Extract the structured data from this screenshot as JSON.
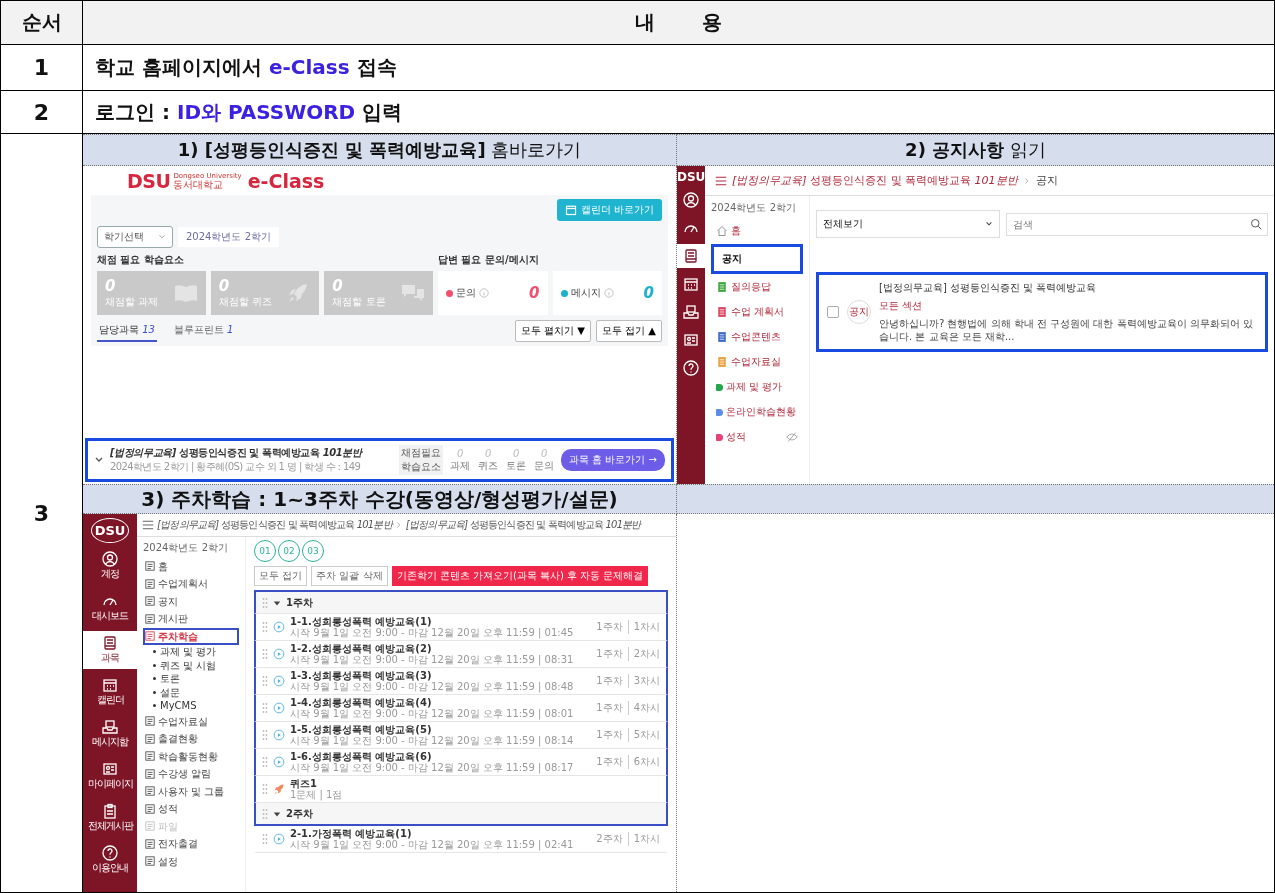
{
  "table": {
    "columns": [
      "순서",
      "내 용"
    ]
  },
  "steps": [
    {
      "number": "1",
      "text": "학교 홈페이지에서 **e-Class** 접속"
    },
    {
      "number": "2",
      "text": "로그인 : **ID와 PASSWORD** 입력"
    },
    {
      "number": "3",
      "panels": [
        {
          "caption": "**1) [성평등인식증진 및 폭력예방교육]** 홈바로가기",
          "caption_bold": false,
          "screen": {
            "kind": "dashboard",
            "logo": {
              "mark": "DSU",
              "name_en": "Dongseo University",
              "name_ko": "동서대학교",
              "product": "e-Class"
            },
            "calendar_button": "캘린더 바로가기",
            "semester_select": "학기선택",
            "semester_value": "2024학년도 2학기",
            "grading_title": "채점 필요 학습요소",
            "grading_cards": [
              {
                "kind": "book",
                "count": "0",
                "label": "채점할 과제"
              },
              {
                "kind": "rocket",
                "count": "0",
                "label": "채점할 퀴즈"
              },
              {
                "kind": "chat",
                "count": "0",
                "label": "채점할 토론"
              }
            ],
            "reply_title": "답변 필요 문의/메시지",
            "reply_cards": [
              {
                "label": "문의",
                "count": "0",
                "color": "#f0506e"
              },
              {
                "label": "메시지",
                "count": "0",
                "color": "#1ab0d0"
              }
            ],
            "tabs": [
              {
                "label": "담당과목",
                "count": "13",
                "selected": true
              },
              {
                "label": "블루프린트",
                "count": "1",
                "selected": false
              }
            ],
            "buttons": [
              "모두 펼치기 ▼",
              "모두 접기 ▲"
            ],
            "course": {
              "title": "*[법정의무교육]* 성평등인식증진 및 폭력예방교육 *101분반*",
              "meta": "2024학년도 2학기 | 황주혜(0S) 교수 외 1 명 | 학생 수 : 149",
              "stats_label": "채점필요 학습요소",
              "stats": [
                {
                  "value": "0",
                  "label": "과제"
                },
                {
                  "value": "0",
                  "label": "퀴즈"
                },
                {
                  "value": "0",
                  "label": "토론"
                },
                {
                  "value": "0",
                  "label": "문의"
                }
              ],
              "button": "과목 홈 바로가기 →",
              "highlighted": true
            }
          }
        },
        {
          "caption": "**2) 공지사항** 읽기",
          "caption_bold": false,
          "screen": {
            "kind": "notices",
            "logo": "DSU",
            "rail": [
              {
                "kind": "person",
                "selected": false
              },
              {
                "kind": "gauge",
                "selected": false
              },
              {
                "kind": "book",
                "selected": true
              },
              {
                "kind": "calendar",
                "selected": false
              },
              {
                "kind": "tray",
                "selected": false
              },
              {
                "kind": "card",
                "selected": false
              },
              {
                "kind": "help",
                "selected": false
              }
            ],
            "breadcrumb": [
              "*[법정의무교육]* 성평등인식증진 및 폭력예방교육 *101분반*",
              "공지"
            ],
            "semester": "2024학년도 2학기",
            "menu": [
              {
                "kind": "home",
                "label": "홈",
                "selected": false,
                "highlighted": false,
                "hidden": false
              },
              {
                "kind": "plain",
                "label": "공지",
                "selected": true,
                "highlighted": true,
                "hidden": false
              },
              {
                "kind": "document",
                "label": "질의응답",
                "color": "#3aa53a",
                "selected": false,
                "highlighted": false,
                "hidden": false
              },
              {
                "kind": "document",
                "label": "수업 계획서",
                "color": "#d9455f",
                "selected": false,
                "highlighted": false,
                "hidden": false
              },
              {
                "kind": "document",
                "label": "수업콘텐츠",
                "color": "#3a66c4",
                "selected": false,
                "highlighted": false,
                "hidden": false
              },
              {
                "kind": "document",
                "label": "수업자료실",
                "color": "#e8a03c",
                "selected": false,
                "highlighted": false,
                "hidden": false
              },
              {
                "kind": "dot",
                "label": "과제 및 평가",
                "color": "#22a64a",
                "selected": false,
                "highlighted": false,
                "hidden": false
              },
              {
                "kind": "dot",
                "label": "온라인학습현황",
                "color": "#5b8ce8",
                "selected": false,
                "highlighted": false,
                "hidden": false
              },
              {
                "kind": "dot",
                "label": "성적",
                "color": "#e8407a",
                "selected": false,
                "highlighted": false,
                "hidden": true
              }
            ],
            "filter": "전체보기",
            "search_placeholder": "검색",
            "notice": {
              "title": "[법정의무교육] 성평등인식증진 및 폭력예방교육",
              "badge": "공지",
              "section": "모든 섹션",
              "excerpt": "안녕하십니까? 현행법에 의해 학내 전 구성원에 대한 폭력예방교육이 의무화되어 있습니다. 본 교육은 모든 재학...",
              "checked": false,
              "highlighted": true
            }
          }
        },
        {
          "caption": "3) 주차학습 : 1~3주차 수강(동영상/형성평가/설문)",
          "caption_bold": true,
          "screen": {
            "kind": "weekly",
            "logo": "DSU",
            "rail": [
              {
                "kind": "person",
                "label": "계정",
                "selected": false
              },
              {
                "kind": "gauge",
                "label": "대시보드",
                "selected": false
              },
              {
                "kind": "book",
                "label": "과목",
                "selected": true
              },
              {
                "kind": "calendar",
                "label": "캘린더",
                "selected": false
              },
              {
                "kind": "tray",
                "label": "메시지함",
                "selected": false
              },
              {
                "kind": "card",
                "label": "마이페이지",
                "selected": false
              },
              {
                "kind": "clipboard",
                "label": "전체게시판",
                "selected": false
              },
              {
                "kind": "help",
                "label": "이용안내",
                "selected": false
              }
            ],
            "breadcrumb": [
              "*[법정의무교육]* 성평등인식증진 및 폭력예방교육 *101분반*",
              "*[법정의무교육]* 성평등인식증진 및 폭력예방교육 *101분반*"
            ],
            "semester": "2024학년도 2학기",
            "menu": [
              {
                "label": "홈",
                "selected": false,
                "disabled": false,
                "highlighted": false
              },
              {
                "label": "수업계획서",
                "selected": false,
                "disabled": false,
                "highlighted": false
              },
              {
                "label": "공지",
                "selected": false,
                "disabled": false,
                "highlighted": false
              },
              {
                "label": "게시판",
                "selected": false,
                "disabled": false,
                "highlighted": false
              },
              {
                "label": "주차학습",
                "selected": true,
                "disabled": false,
                "highlighted": true,
                "children": [
                  {
                    "label": "과제 및 평가"
                  },
                  {
                    "label": "퀴즈 및 시험"
                  },
                  {
                    "label": "토론"
                  },
                  {
                    "label": "설문"
                  },
                  {
                    "label": "MyCMS"
                  }
                ]
              },
              {
                "label": "수업자료실",
                "selected": false,
                "disabled": false,
                "highlighted": false
              },
              {
                "label": "출결현황",
                "selected": false,
                "disabled": false,
                "highlighted": false
              },
              {
                "label": "학습활동현황",
                "selected": false,
                "disabled": false,
                "highlighted": false
              },
              {
                "label": "수강생 알림",
                "selected": false,
                "disabled": false,
                "highlighted": false
              },
              {
                "label": "사용자 및 그룹",
                "selected": false,
                "disabled": false,
                "highlighted": false
              },
              {
                "label": "성적",
                "selected": false,
                "disabled": false,
                "highlighted": false
              },
              {
                "label": "파일",
                "selected": false,
                "disabled": true,
                "highlighted": false
              },
              {
                "label": "전자출결",
                "selected": false,
                "disabled": false,
                "highlighted": false
              },
              {
                "label": "설정",
                "selected": false,
                "disabled": false,
                "highlighted": false
              }
            ],
            "weeks": [
              "01",
              "02",
              "03"
            ],
            "toolbar": [
              "모두 접기",
              "주차 일괄 삭제"
            ],
            "action_button": "기존학기 콘텐츠 가져오기(과목 복사) 후 자동 문제해결",
            "sections": [
              {
                "title": "1주차",
                "expanded": true,
                "highlighted": true,
                "items": [
                  {
                    "kind": "video",
                    "title": "1-1.성희롱성폭력 예방교육(1)",
                    "meta": "시작 9월 1일 오전 9:00 - 마감 12월 20일 오후 11:59 | 01:45",
                    "week": "1주차",
                    "period": "1차시",
                    "highlighted": true
                  },
                  {
                    "kind": "video",
                    "title": "1-2.성희롱성폭력 예방교육(2)",
                    "meta": "시작 9월 1일 오전 9:00 - 마감 12월 20일 오후 11:59 | 08:31",
                    "week": "1주차",
                    "period": "2차시",
                    "highlighted": true
                  },
                  {
                    "kind": "video",
                    "title": "1-3.성희롱성폭력 예방교육(3)",
                    "meta": "시작 9월 1일 오전 9:00 - 마감 12월 20일 오후 11:59 | 08:48",
                    "week": "1주차",
                    "period": "3차시",
                    "highlighted": true
                  },
                  {
                    "kind": "video",
                    "title": "1-4.성희롱성폭력 예방교육(4)",
                    "meta": "시작 9월 1일 오전 9:00 - 마감 12월 20일 오후 11:59 | 08:01",
                    "week": "1주차",
                    "period": "4차시",
                    "highlighted": true
                  },
                  {
                    "kind": "video",
                    "title": "1-5.성희롱성폭력 예방교육(5)",
                    "meta": "시작 9월 1일 오전 9:00 - 마감 12월 20일 오후 11:59 | 08:14",
                    "week": "1주차",
                    "period": "5차시",
                    "highlighted": true
                  },
                  {
                    "kind": "video",
                    "title": "1-6.성희롱성폭력 예방교육(6)",
                    "meta": "시작 9월 1일 오전 9:00 - 마감 12월 20일 오후 11:59 | 08:17",
                    "week": "1주차",
                    "period": "6차시",
                    "highlighted": true
                  },
                  {
                    "kind": "quiz",
                    "title": "퀴즈1",
                    "meta": "1문제 | 1점",
                    "highlighted": true
                  }
                ]
              },
              {
                "title": "2주차",
                "expanded": true,
                "highlighted": true,
                "items": [
                  {
                    "kind": "video",
                    "title": "2-1.가정폭력 예방교육(1)",
                    "meta": "시작 9월 1일 오전 9:00 - 마감 12월 20일 오후 11:59 | 02:41",
                    "week": "2주차",
                    "period": "1차시",
                    "highlighted": false
                  }
                ]
              }
            ]
          }
        }
      ]
    }
  ]
}
